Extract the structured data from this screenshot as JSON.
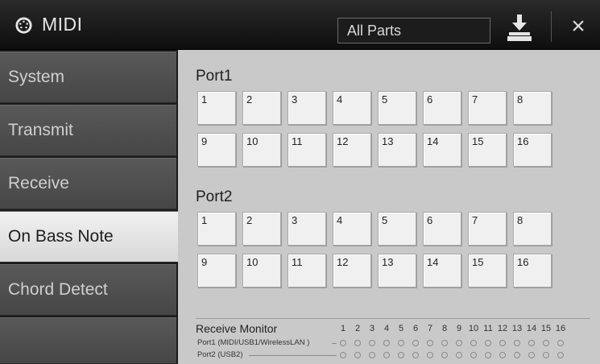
{
  "header": {
    "title": "MIDI",
    "part_selector": "All Parts",
    "save_icon": "save-download-icon",
    "close_icon": "close-icon",
    "close_glyph": "×"
  },
  "sidebar": {
    "items": [
      {
        "label": "System",
        "active": false
      },
      {
        "label": "Transmit",
        "active": false
      },
      {
        "label": "Receive",
        "active": false
      },
      {
        "label": "On Bass Note",
        "active": true
      },
      {
        "label": "Chord Detect",
        "active": false
      },
      {
        "label": "",
        "active": false
      }
    ]
  },
  "main": {
    "ports": [
      {
        "label": "Port1",
        "channels": [
          "1",
          "2",
          "3",
          "4",
          "5",
          "6",
          "7",
          "8",
          "9",
          "10",
          "11",
          "12",
          "13",
          "14",
          "15",
          "16"
        ]
      },
      {
        "label": "Port2",
        "channels": [
          "1",
          "2",
          "3",
          "4",
          "5",
          "6",
          "7",
          "8",
          "9",
          "10",
          "11",
          "12",
          "13",
          "14",
          "15",
          "16"
        ]
      }
    ],
    "receive_monitor": {
      "title": "Receive Monitor",
      "channel_numbers": [
        "1",
        "2",
        "3",
        "4",
        "5",
        "6",
        "7",
        "8",
        "9",
        "10",
        "11",
        "12",
        "13",
        "14",
        "15",
        "16"
      ],
      "rows": [
        {
          "label": "Port1 (MIDI/USB1/WirelessLAN )"
        },
        {
          "label": "Port2 (USB2)"
        }
      ]
    }
  },
  "colors": {
    "active_tab": "#e6e6e6",
    "inactive_tab": "#4f4f4f",
    "panel_bg": "#c9c9c9",
    "title_bar": "#1a1a1a"
  }
}
